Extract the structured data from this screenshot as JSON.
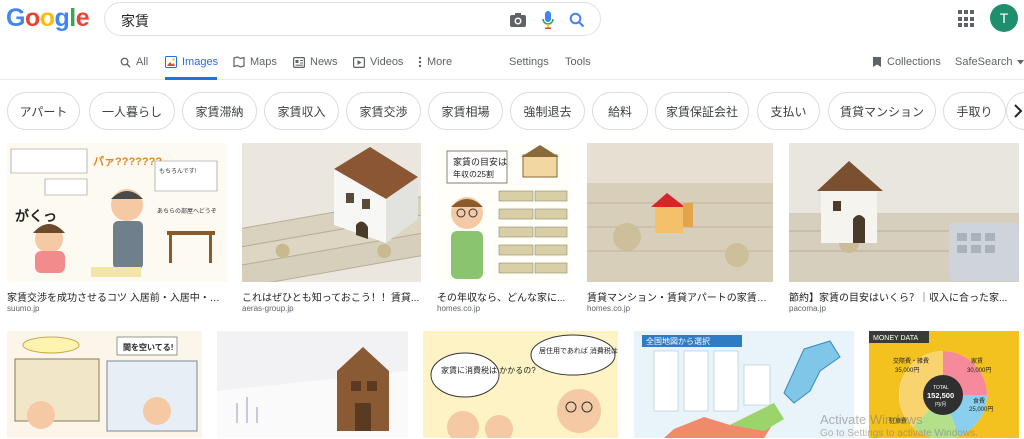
{
  "logo": {
    "letters": [
      "G",
      "o",
      "o",
      "g",
      "l",
      "e"
    ],
    "colors": [
      "#4285f4",
      "#ea4335",
      "#fbbc05",
      "#4285f4",
      "#34a853",
      "#ea4335"
    ]
  },
  "search": {
    "query": "家賃",
    "icons": [
      "camera-icon",
      "mic-icon",
      "search-icon"
    ]
  },
  "account": {
    "initial": "T",
    "color": "#1e8e6e"
  },
  "nav": {
    "tabs": [
      {
        "label": "All",
        "icon": "search-icon"
      },
      {
        "label": "Images",
        "icon": "image-icon",
        "active": true
      },
      {
        "label": "Maps",
        "icon": "map-icon"
      },
      {
        "label": "News",
        "icon": "news-icon"
      },
      {
        "label": "Videos",
        "icon": "video-icon"
      },
      {
        "label": "More",
        "icon": "more-vert-icon"
      }
    ],
    "settings": "Settings",
    "tools": "Tools",
    "collections": "Collections",
    "safesearch": "SafeSearch"
  },
  "chips": [
    "アパート",
    "一人暮らし",
    "家賃滞納",
    "家賃収入",
    "家賃交渉",
    "家賃相場",
    "強制退去",
    "給料",
    "家賃保証会社",
    "支払い",
    "賃貸マンション",
    "手取り"
  ],
  "results_row1": [
    {
      "title": "家賃交渉を成功させるコツ 入居前・入居中・更...",
      "source": "suumo.jp",
      "illustration_texts": [
        "パァ???????",
        "がくっ",
        "もちろんです!",
        "あちらの部屋へどうぞ"
      ]
    },
    {
      "title": "これはぜひとも知っておこう！！賃貸...",
      "source": "aeras-group.jp"
    },
    {
      "title": "その年収なら、どんな家に...",
      "source": "homes.co.jp",
      "illustration_texts": [
        "家賃の目安は",
        "年収の25割"
      ]
    },
    {
      "title": "賃貸マンション・賃貸アパートの家賃は...",
      "source": "homes.co.jp"
    },
    {
      "title": "節約】家賃の目安はいくら？｜収入に合った家...",
      "source": "pacoma.jp"
    }
  ],
  "results_row2": [
    {
      "illustration_texts": [
        "間を空いてる!"
      ]
    },
    {},
    {
      "illustration_texts": [
        "家賃に消費税は かかるの?",
        "居住用であれば 消費税はかかりませんぜ"
      ]
    },
    {
      "illustration_texts": [
        "全国地図から選択"
      ]
    },
    {
      "illustration_texts": [
        "MONEY DATA",
        "交際費・雑費",
        "35,000円",
        "家賃",
        "30,000円",
        "TOTAL",
        "152,500",
        "円/月",
        "食費",
        "25,000円",
        "駐車費"
      ]
    }
  ],
  "watermark": {
    "line1": "Activate Windows",
    "line2": "Go to Settings to activate Windows."
  }
}
